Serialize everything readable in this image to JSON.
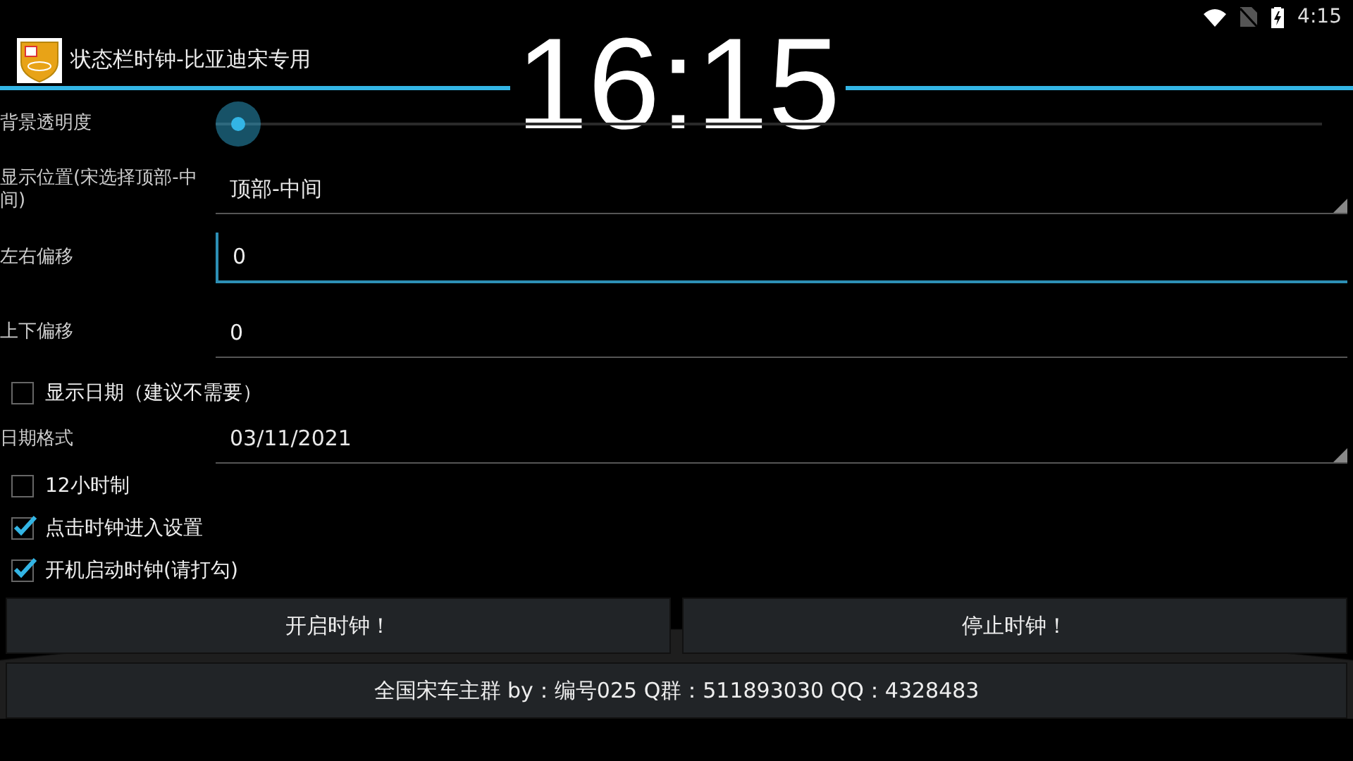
{
  "status_bar": {
    "time": "4:15"
  },
  "app_bar": {
    "title": "状态栏时钟-比亚迪宋专用"
  },
  "clock_overlay": "16:15",
  "settings": [
    {
      "kind": "slider",
      "label": "背景透明度",
      "level": 0
    },
    {
      "kind": "spinner",
      "label": "显示位置(宋选择顶部-中间)",
      "value": "顶部-中间"
    },
    {
      "kind": "text",
      "label": "左右偏移",
      "value": "0",
      "focused": true
    },
    {
      "kind": "text",
      "label": "上下偏移",
      "value": "0",
      "focused": false
    },
    {
      "kind": "checkbox",
      "label": "显示日期（建议不需要）",
      "checked": false
    },
    {
      "kind": "spinner",
      "label": "日期格式",
      "value": "03/11/2021"
    },
    {
      "kind": "checkbox",
      "label": "12小时制",
      "checked": false
    },
    {
      "kind": "checkbox",
      "label": "点击时钟进入设置",
      "checked": true
    },
    {
      "kind": "checkbox",
      "label": "开机启动时钟(请打勾)",
      "checked": true
    }
  ],
  "buttons": [
    "开启时钟！",
    "停止时钟！"
  ],
  "footer_button": "全国宋车主群 by：编号025 Q群：511893030 QQ：4328483"
}
